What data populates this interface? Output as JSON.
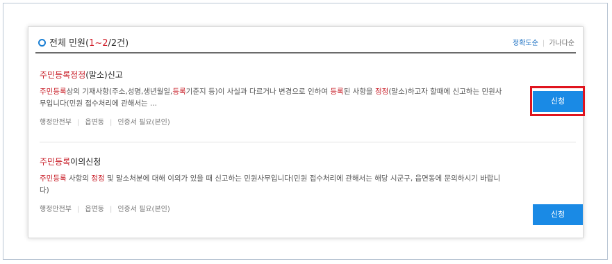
{
  "header": {
    "title_prefix": "전체 민원(",
    "range": "1~2",
    "title_suffix": "/2건)",
    "sort_accuracy": "정확도순",
    "sort_alpha": "가나다순"
  },
  "items": [
    {
      "title_red": "주민등록정정",
      "title_rest": "(말소)신고",
      "desc": [
        {
          "t": "주민등록",
          "red": true
        },
        {
          "t": "상의 기재사항(주소,성명,생년월일,",
          "red": false
        },
        {
          "t": "등록",
          "red": true
        },
        {
          "t": "기준지 등)이 사실과 다르거나 변경으로 인하여 ",
          "red": false
        },
        {
          "t": "등록",
          "red": true
        },
        {
          "t": "된 사항을 ",
          "red": false
        },
        {
          "t": "정정",
          "red": true
        },
        {
          "t": "(말소)하고자 할때에 신고하는 민원사무입니다(민원 접수처리에 관해서는 ...",
          "red": false
        }
      ],
      "meta": [
        "행정안전부",
        "읍면동",
        "인증서 필요(본인)"
      ],
      "button": "신청"
    },
    {
      "title_red": "주민등록",
      "title_rest": "이의신청",
      "desc": [
        {
          "t": "주민등록",
          "red": true
        },
        {
          "t": " 사항의 ",
          "red": false
        },
        {
          "t": "정정",
          "red": true
        },
        {
          "t": " 및 말소처분에 대해 이의가 있을 때 신고하는 민원사무입니다(민원 접수처리에 관해서는 해당 시군구, 읍면동에 문의하시기 바랍니다)",
          "red": false
        }
      ],
      "meta": [
        "행정안전부",
        "읍면동",
        "인증서 필요(본인)"
      ],
      "button": "신청"
    }
  ],
  "colors": {
    "accent": "#1a8ae5",
    "highlight": "#e0141e",
    "keyword": "#c9202a"
  }
}
